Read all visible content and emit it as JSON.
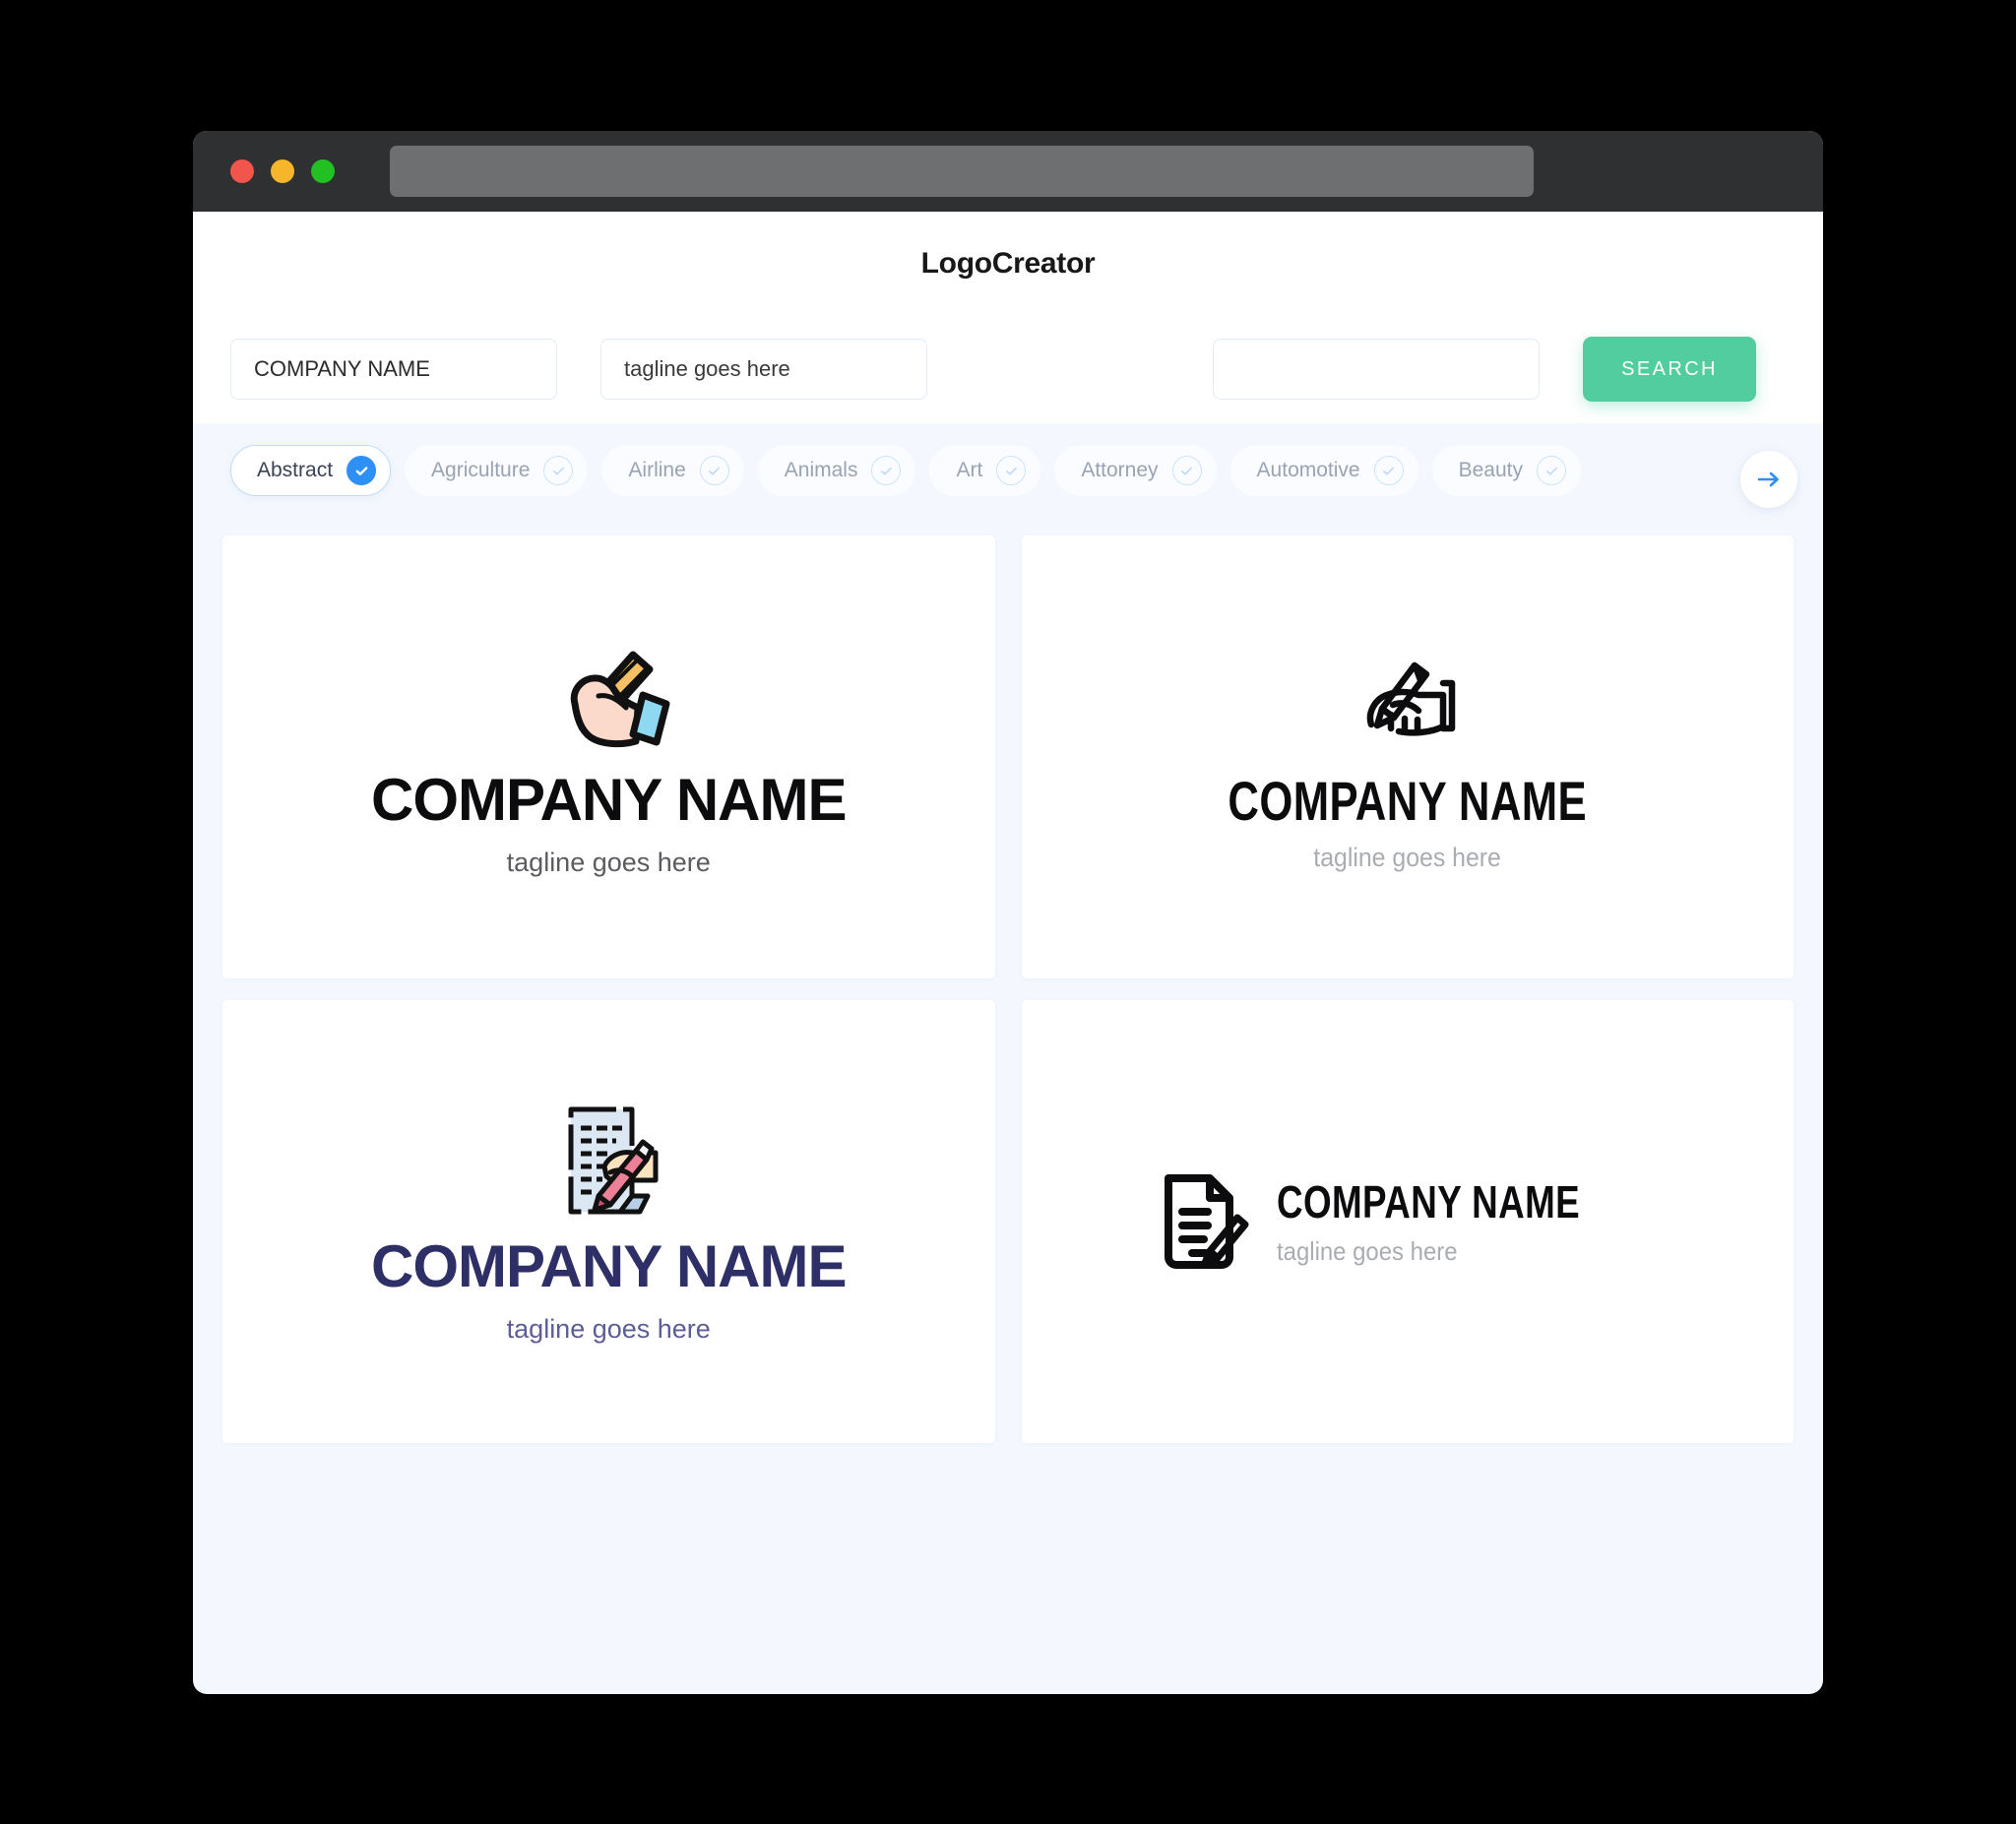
{
  "window": {
    "traffic_lights": [
      {
        "name": "close",
        "color": "#F2554B"
      },
      {
        "name": "minimize",
        "color": "#F6B52A"
      },
      {
        "name": "maximize",
        "color": "#23C024"
      }
    ],
    "url_value": ""
  },
  "header": {
    "title": "LogoCreator"
  },
  "search": {
    "company_value": "COMPANY NAME",
    "company_placeholder": "COMPANY NAME",
    "tagline_value": "tagline goes here",
    "tagline_placeholder": "tagline goes here",
    "extra_value": "",
    "extra_placeholder": "",
    "search_label": "SEARCH",
    "search_color": "#51CDA0"
  },
  "categories": {
    "next_icon": "arrow-right-icon",
    "accent_active": "#2E90F5",
    "items": [
      {
        "label": "Abstract",
        "selected": true
      },
      {
        "label": "Agriculture",
        "selected": false
      },
      {
        "label": "Airline",
        "selected": false
      },
      {
        "label": "Animals",
        "selected": false
      },
      {
        "label": "Art",
        "selected": false
      },
      {
        "label": "Attorney",
        "selected": false
      },
      {
        "label": "Automotive",
        "selected": false
      },
      {
        "label": "Beauty",
        "selected": false
      }
    ]
  },
  "logos": [
    {
      "icon": "hand-pencil-card-color-icon",
      "name": "COMPANY NAME",
      "tagline": "tagline goes here",
      "name_color": "#0C0C0E",
      "tagline_color": "#5B5B60",
      "layout": "stacked"
    },
    {
      "icon": "hand-writing-outline-icon",
      "name": "COMPANY NAME",
      "tagline": "tagline goes here",
      "name_color": "#0C0C0E",
      "tagline_color": "#A9ACB2",
      "layout": "stacked"
    },
    {
      "icon": "document-hand-pencil-color-icon",
      "name": "COMPANY NAME",
      "tagline": "tagline goes here",
      "name_color": "#2E2F66",
      "tagline_color": "#5C5E95",
      "layout": "stacked"
    },
    {
      "icon": "document-pencil-outline-icon",
      "name": "COMPANY NAME",
      "tagline": "tagline goes here",
      "name_color": "#0C0C0E",
      "tagline_color": "#A9ACB2",
      "layout": "horizontal"
    }
  ]
}
